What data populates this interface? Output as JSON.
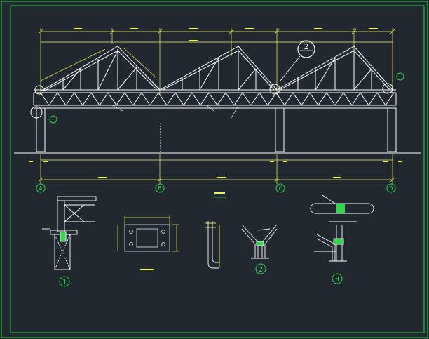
{
  "colors": {
    "background": "#212830",
    "border": "#2fd94a",
    "line": "#ffffff",
    "dimension": "#f2f25a",
    "axis": "#2fd94a",
    "callout": "#ffffff"
  },
  "axes": {
    "labels": [
      "A",
      "B",
      "C",
      "D"
    ]
  },
  "detail_labels": {
    "detail_1": "1",
    "detail_2": "2",
    "detail_3": "3",
    "callout_2": "2"
  }
}
